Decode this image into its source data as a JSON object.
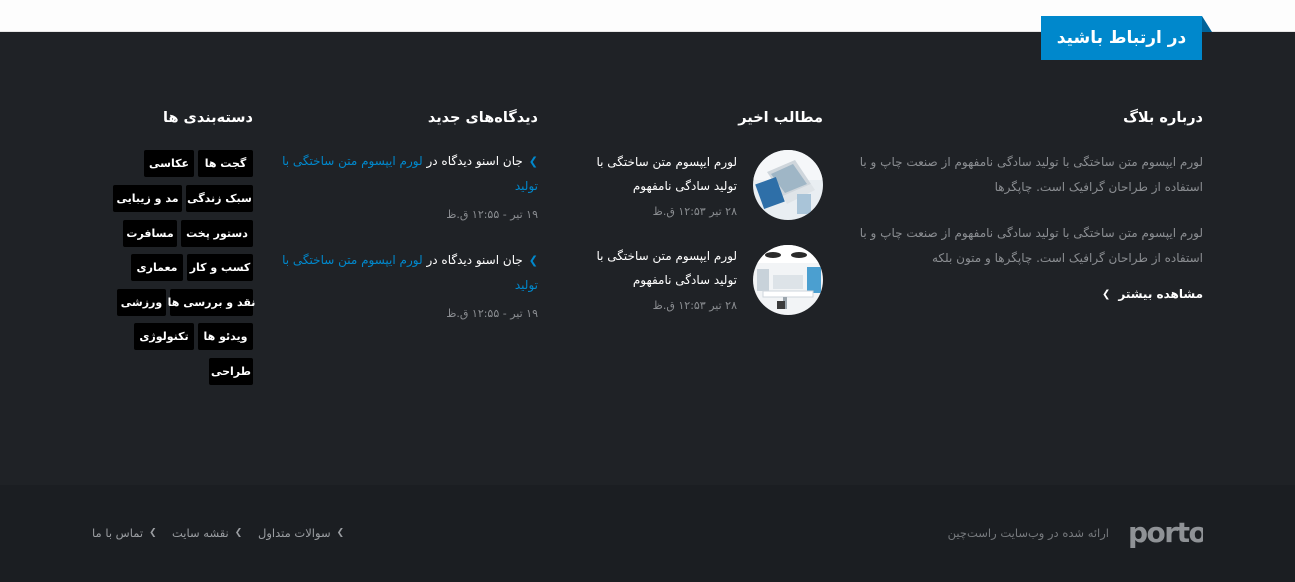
{
  "contact": {
    "label": "در ارتباط باشید"
  },
  "about": {
    "title": "درباره بلاگ",
    "paragraph1": "لورم ایپسوم متن ساختگی با تولید سادگی نامفهوم از صنعت چاپ و با استفاده از طراحان گرافیک است. چاپگرها",
    "paragraph2": "لورم ایپسوم متن ساختگی با تولید سادگی نامفهوم از صنعت چاپ و با استفاده از طراحان گرافیک است. چاپگرها و متون بلکه",
    "more_label": "مشاهده بیشتر"
  },
  "recent": {
    "title": "مطالب اخیر",
    "posts": [
      {
        "title": "لورم ایپسوم متن ساختگی با تولید سادگی نامفهوم",
        "date": "۲۸ تیر ۱۲:۵۳ ق.ظ"
      },
      {
        "title": "لورم ایپسوم متن ساختگی با تولید سادگی نامفهوم",
        "date": "۲۸ تیر ۱۲:۵۳ ق.ظ"
      }
    ]
  },
  "comments": {
    "title": "دیدگاه‌های جدید",
    "items": [
      {
        "author_text": "جان اسنو دیدگاه در",
        "link_text": "لورم ایپسوم متن ساختگی با تولید",
        "date": "۱۹ تیر - ۱۲:۵۵ ق.ظ"
      },
      {
        "author_text": "جان اسنو دیدگاه در",
        "link_text": "لورم ایپسوم متن ساختگی با تولید",
        "date": "۱۹ تیر - ۱۲:۵۵ ق.ظ"
      }
    ]
  },
  "categories": {
    "title": "دسته‌بندی ها",
    "tags": [
      "گجت ها",
      "عکاسی",
      "سبک زندگی",
      "مد و زیبایی",
      "دستور پخت",
      "مسافرت",
      "کسب و کار",
      "معماری",
      "نقد و بررسی ها",
      "ورزشی",
      "ویدئو ها",
      "تکنولوژی",
      "طراحی"
    ]
  },
  "footer": {
    "logo_text": "porto",
    "credit": "ارائه شده در وب‌سایت راست‌چین",
    "nav": [
      "سوالات متداول",
      "نقشه سایت",
      "تماس با ما"
    ]
  },
  "colors": {
    "accent": "#0088cc",
    "footer_bg": "#1f2226",
    "footer_bottom_bg": "#1b1e22",
    "tag_bg": "#000000"
  },
  "icons": {
    "chevron": "chevron-left-icon"
  }
}
